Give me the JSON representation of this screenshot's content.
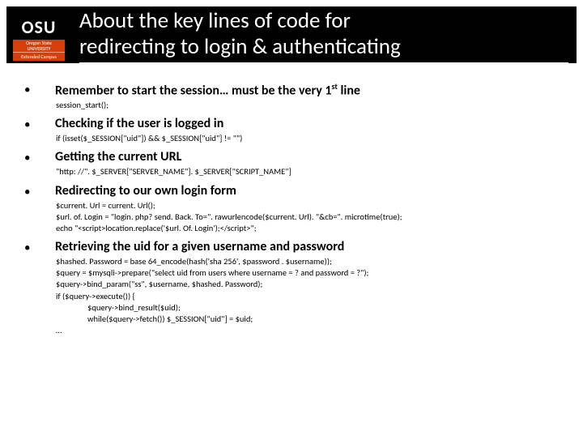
{
  "logo": {
    "top": "OSU",
    "mid_line1": "Oregon State",
    "mid_line2": "UNIVERSITY",
    "bot": "Extended Campus"
  },
  "title_line1": "About the key lines of code for",
  "title_line2": "redirecting to login & authenticating",
  "items": [
    {
      "heading_pre": "Remember to start the session… must be the very 1",
      "heading_sup": "st",
      "heading_post": " line",
      "code": [
        "session_start();"
      ]
    },
    {
      "heading": "Checking if the user is logged in",
      "code": [
        "if (isset($_SESSION[\"uid\"]) && $_SESSION[\"uid\"] != \"\")"
      ]
    },
    {
      "heading": "Getting the current URL",
      "code": [
        "\"http: //\". $_SERVER[\"SERVER_NAME\"]. $_SERVER[\"SCRIPT_NAME\"]"
      ]
    },
    {
      "heading": "Redirecting to our own login form",
      "code": [
        "$current. Url = current. Url();",
        "$url. of. Login =  \"login. php? send. Back. To=\". rawurlencode($current. Url). \"&cb=\". microtime(true);",
        "echo \"<script>location.replace('$url. Of. Login');</script>\";"
      ]
    },
    {
      "heading": "Retrieving the uid for a given username and password",
      "code": [
        "$hashed. Password =  base 64_encode(hash('sha 256', $password . $username));",
        "$query =  $mysqli->prepare(\"select uid from users where username = ? and password = ?\");",
        "$query->bind_param(\"ss\", $username, $hashed. Password);",
        "if ($query->execute()) {"
      ],
      "code_indent": [
        "$query->bind_result($uid);",
        "while($query->fetch()) $_SESSION[\"uid\"] = $uid;"
      ],
      "trailing": "…"
    }
  ]
}
